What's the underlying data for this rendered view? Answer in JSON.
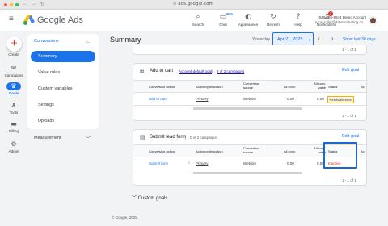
{
  "browser": {
    "url": "ads.google.com"
  },
  "header": {
    "app_title": "Google Ads",
    "tools": [
      {
        "label": "Search",
        "icon": "search-icon"
      },
      {
        "label": "Chat",
        "icon": "chat-icon",
        "badge": "BETA"
      },
      {
        "label": "Appearance",
        "icon": "appearance-icon"
      },
      {
        "label": "Refresh",
        "icon": "refresh-icon"
      },
      {
        "label": "Help",
        "icon": "help-icon"
      },
      {
        "label": "Notifications",
        "icon": "bell-icon",
        "count": "2"
      }
    ],
    "account_id": "928-366-5844 Demo Account",
    "account_email": "lucasrollin@datamarketing.co..."
  },
  "rail": {
    "items": [
      {
        "label": "Create",
        "icon": "plus-icon"
      },
      {
        "label": "Campaigns",
        "icon": "megaphone-icon"
      },
      {
        "label": "Goals",
        "icon": "trophy-icon",
        "active": true
      },
      {
        "label": "Tools",
        "icon": "wrench-icon"
      },
      {
        "label": "Billing",
        "icon": "credit-card-icon"
      },
      {
        "label": "Admin",
        "icon": "gear-icon"
      }
    ]
  },
  "nav": {
    "section": "Conversions",
    "items": [
      "Summary",
      "Value rules",
      "Custom variables",
      "Settings",
      "Uploads"
    ],
    "active_index": 0,
    "measurement": "Measurement"
  },
  "toolbar": {
    "page_title": "Summary",
    "date_label": "Yesterday",
    "date_value": "Apr 21, 2025",
    "range_link": "Show last 30 days"
  },
  "top_pager": "1 - 1 of 1",
  "cards": [
    {
      "title": "Add to cart",
      "account_goal": "Account-default goal",
      "campaigns": "2 of 2 campaigns",
      "edit": "Edit goal",
      "columns": [
        "Conversion action",
        "Action optimization",
        "Conversion source",
        "All conv.",
        "All conv. value",
        "Status",
        "Ac"
      ],
      "rows": [
        {
          "action": "Add to cart",
          "optimization": "Primary",
          "source": "Website",
          "all_conv": "0.00",
          "all_value": "0.00",
          "status": "Needs attention"
        }
      ],
      "pager": "1 - 1 of 1"
    },
    {
      "title": "Submit lead form",
      "campaigns": "0 of 2 campaigns",
      "edit": "Edit goal",
      "columns": [
        "Conversion action",
        "Action optimization",
        "Conversion source",
        "All conv.",
        "All conv. value",
        "Status",
        "Ac"
      ],
      "rows": [
        {
          "action": "Submit form",
          "optimization": "Primary",
          "source": "Website",
          "all_conv": "0.00",
          "all_value": "0.00",
          "status": "Inactive"
        }
      ],
      "pager": "1 - 1 of 1"
    }
  ],
  "custom_goals": "Custom goals",
  "footer": "© Google, 2025.",
  "colors": {
    "accent": "#1a73e8",
    "inactive": "#d93025",
    "attention": "#f9ab00",
    "highlight": "#1967d2"
  }
}
